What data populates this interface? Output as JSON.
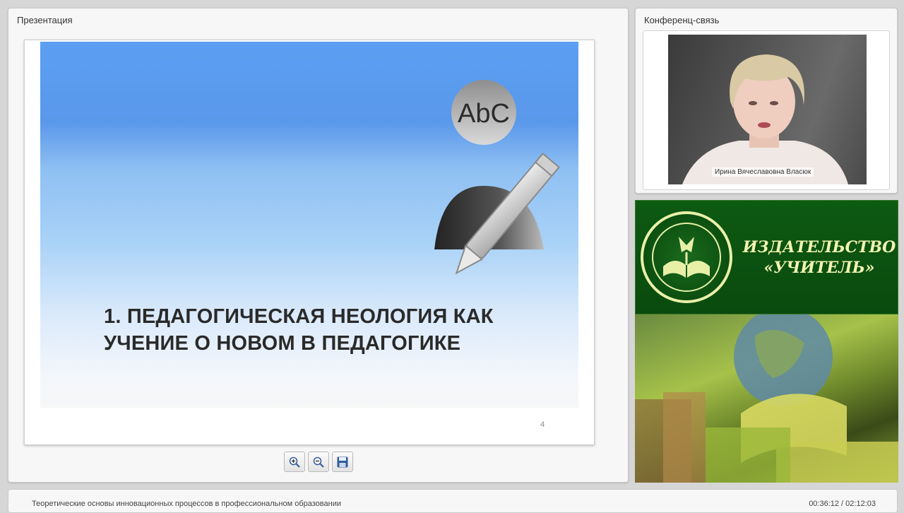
{
  "presentation": {
    "panel_title": "Презентация",
    "slide_title_line1": "1. ПЕДАГОГИЧЕСКАЯ НЕОЛОГИЯ КАК",
    "slide_title_line2": "УЧЕНИЕ О НОВОМ В ПЕДАГОГИКЕ",
    "slide_icon_text": "AbC",
    "slide_number": "4",
    "toolbar": {
      "zoom_in_icon": "zoom-in-icon",
      "zoom_out_icon": "zoom-out-icon",
      "save_icon": "save-icon"
    }
  },
  "conference": {
    "panel_title": "Конференц-связь",
    "speaker_name": "Ирина Вячеславовна Власюк"
  },
  "ad": {
    "line1": "ИЗДАТЕЛЬСТВО",
    "line2": "«УЧИТЕЛЬ»",
    "brand_color": "#0d5a12",
    "text_color": "#f2f4b0"
  },
  "footer": {
    "course_title": "Теоретические основы инновационных процессов в профессиональном образовании",
    "time": "00:36:12 / 02:12:03"
  }
}
